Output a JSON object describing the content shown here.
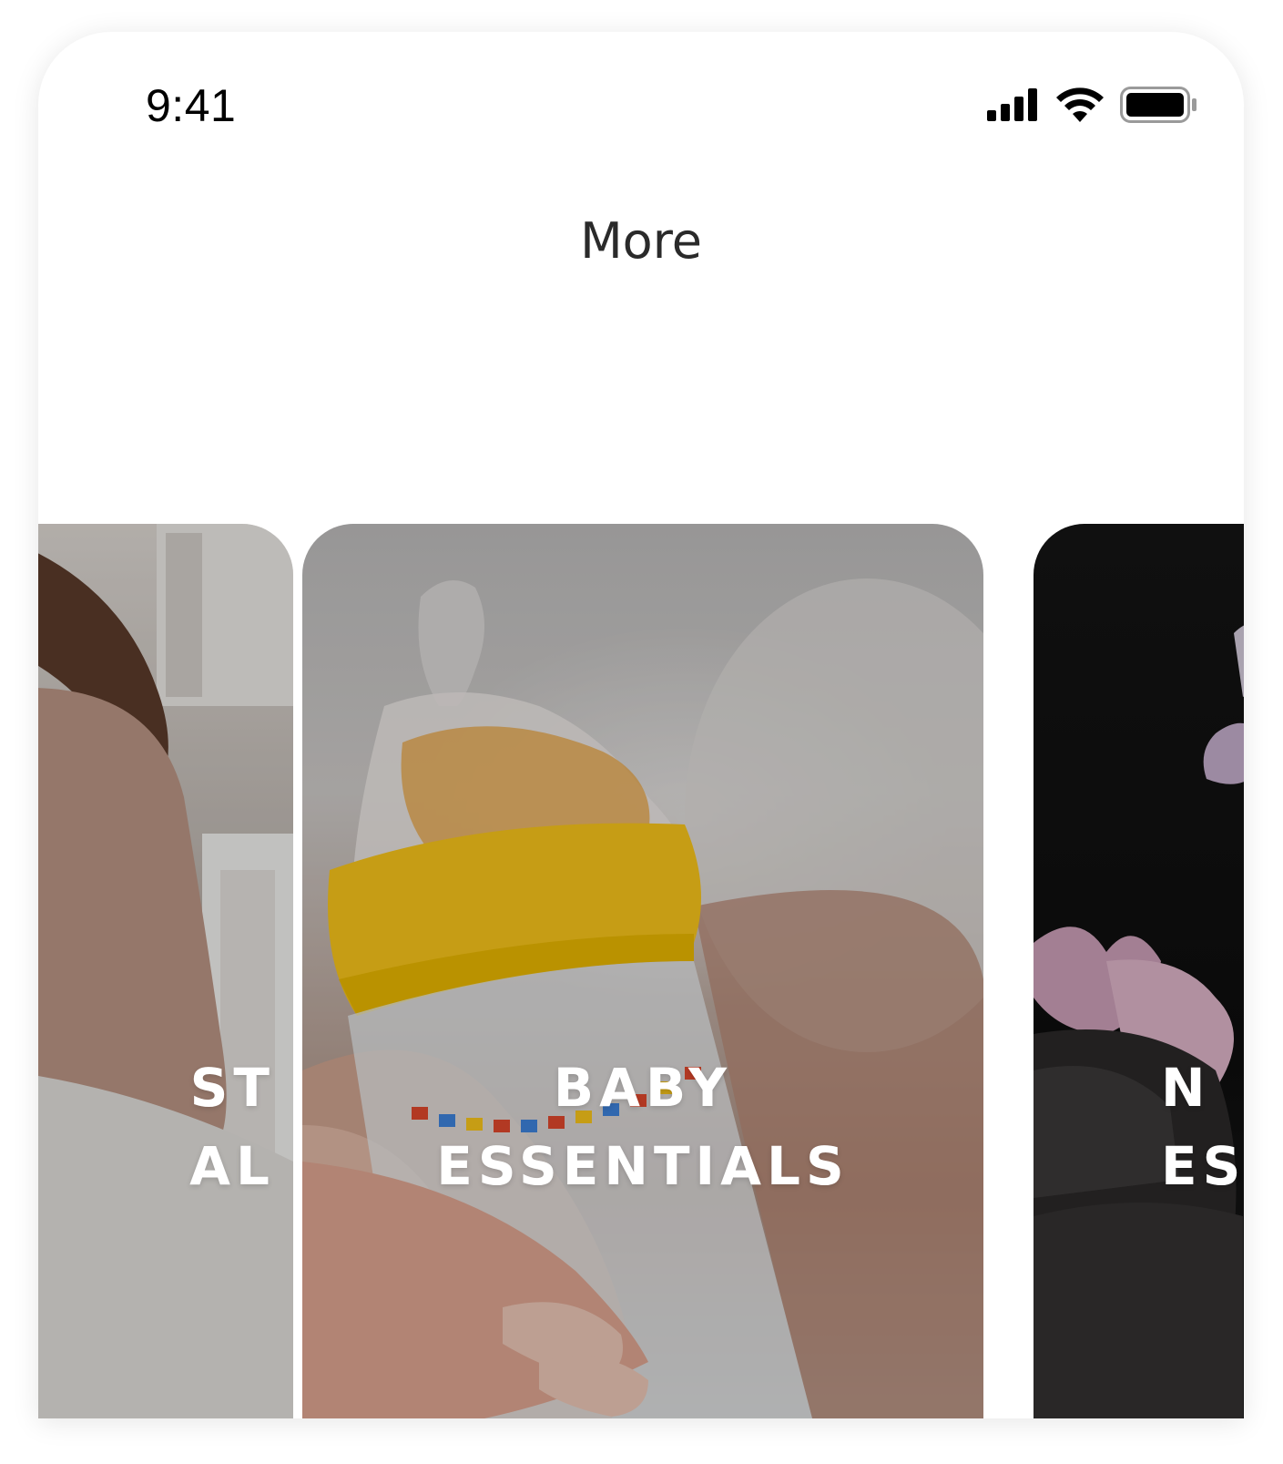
{
  "status_bar": {
    "time": "9:41",
    "icons": [
      "cellular-signal-icon",
      "wifi-icon",
      "battery-icon"
    ]
  },
  "header": {
    "title": "More"
  },
  "carousel": {
    "cards": [
      {
        "line1": "ST",
        "line2": "AL",
        "image": "woman-sitting-by-window"
      },
      {
        "line1": "BABY",
        "line2": "ESSENTIALS",
        "image": "baby-bottle"
      },
      {
        "line1": "N",
        "line2": "ES",
        "image": "black-bottle-with-flowers"
      }
    ]
  },
  "colors": {
    "background": "#ffffff",
    "title_text": "#2a2a2a",
    "card_text": "#ffffff",
    "bottle_cap": "#f2c01a"
  }
}
